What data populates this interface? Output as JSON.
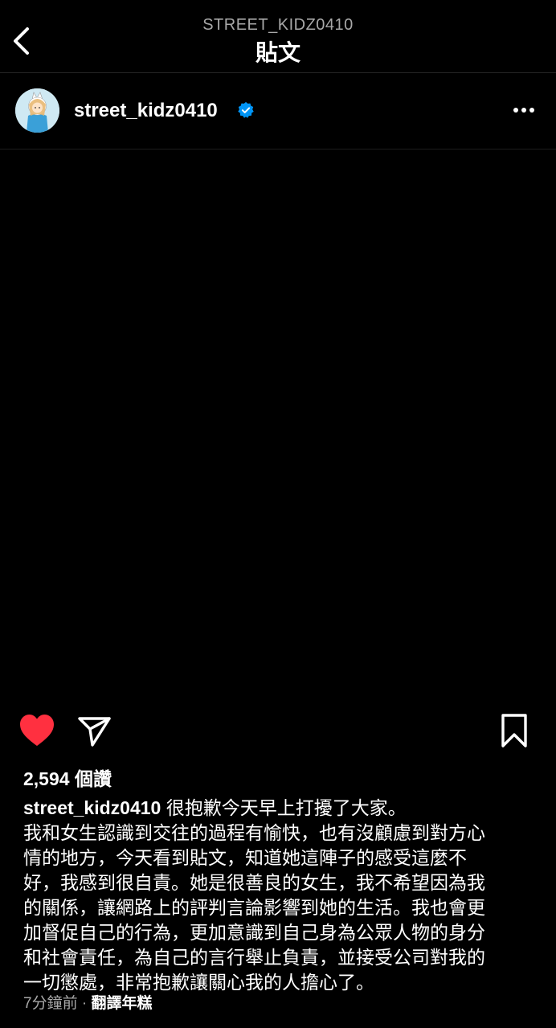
{
  "header": {
    "username_caps": "STREET_KIDZ0410",
    "title": "貼文"
  },
  "post": {
    "username": "street_kidz0410",
    "verified": true,
    "likes_text": "2,594 個讚",
    "caption_first": "很抱歉今天早上打擾了大家。",
    "caption_body": "我和女生認識到交往的過程有愉快，也有沒顧慮到對方心\n情的地方，今天看到貼文，知道她這陣子的感受這麼不\n好，我感到很自責。她是很善良的女生，我不希望因為我\n的關係，讓網路上的評判言論影響到她的生活。我也會更\n加督促自己的行為，更加意識到自己身為公眾人物的身分\n和社會責任，為自己的言行舉止負責，並接受公司對我的\n一切懲處，非常抱歉讓關心我的人擔心了。",
    "time_ago": "7分鐘前",
    "separator": "·",
    "translate_label": "翻譯年糕"
  },
  "icons": {
    "back": "chevron-left-icon",
    "verified": "verified-badge-icon",
    "more": "more-horizontal-icon",
    "like": "heart-filled-icon",
    "share": "paper-plane-icon",
    "save": "bookmark-icon"
  },
  "colors": {
    "background": "#000000",
    "like": "#ff3040",
    "verified": "#0095f6",
    "muted": "#a8a8a8"
  }
}
